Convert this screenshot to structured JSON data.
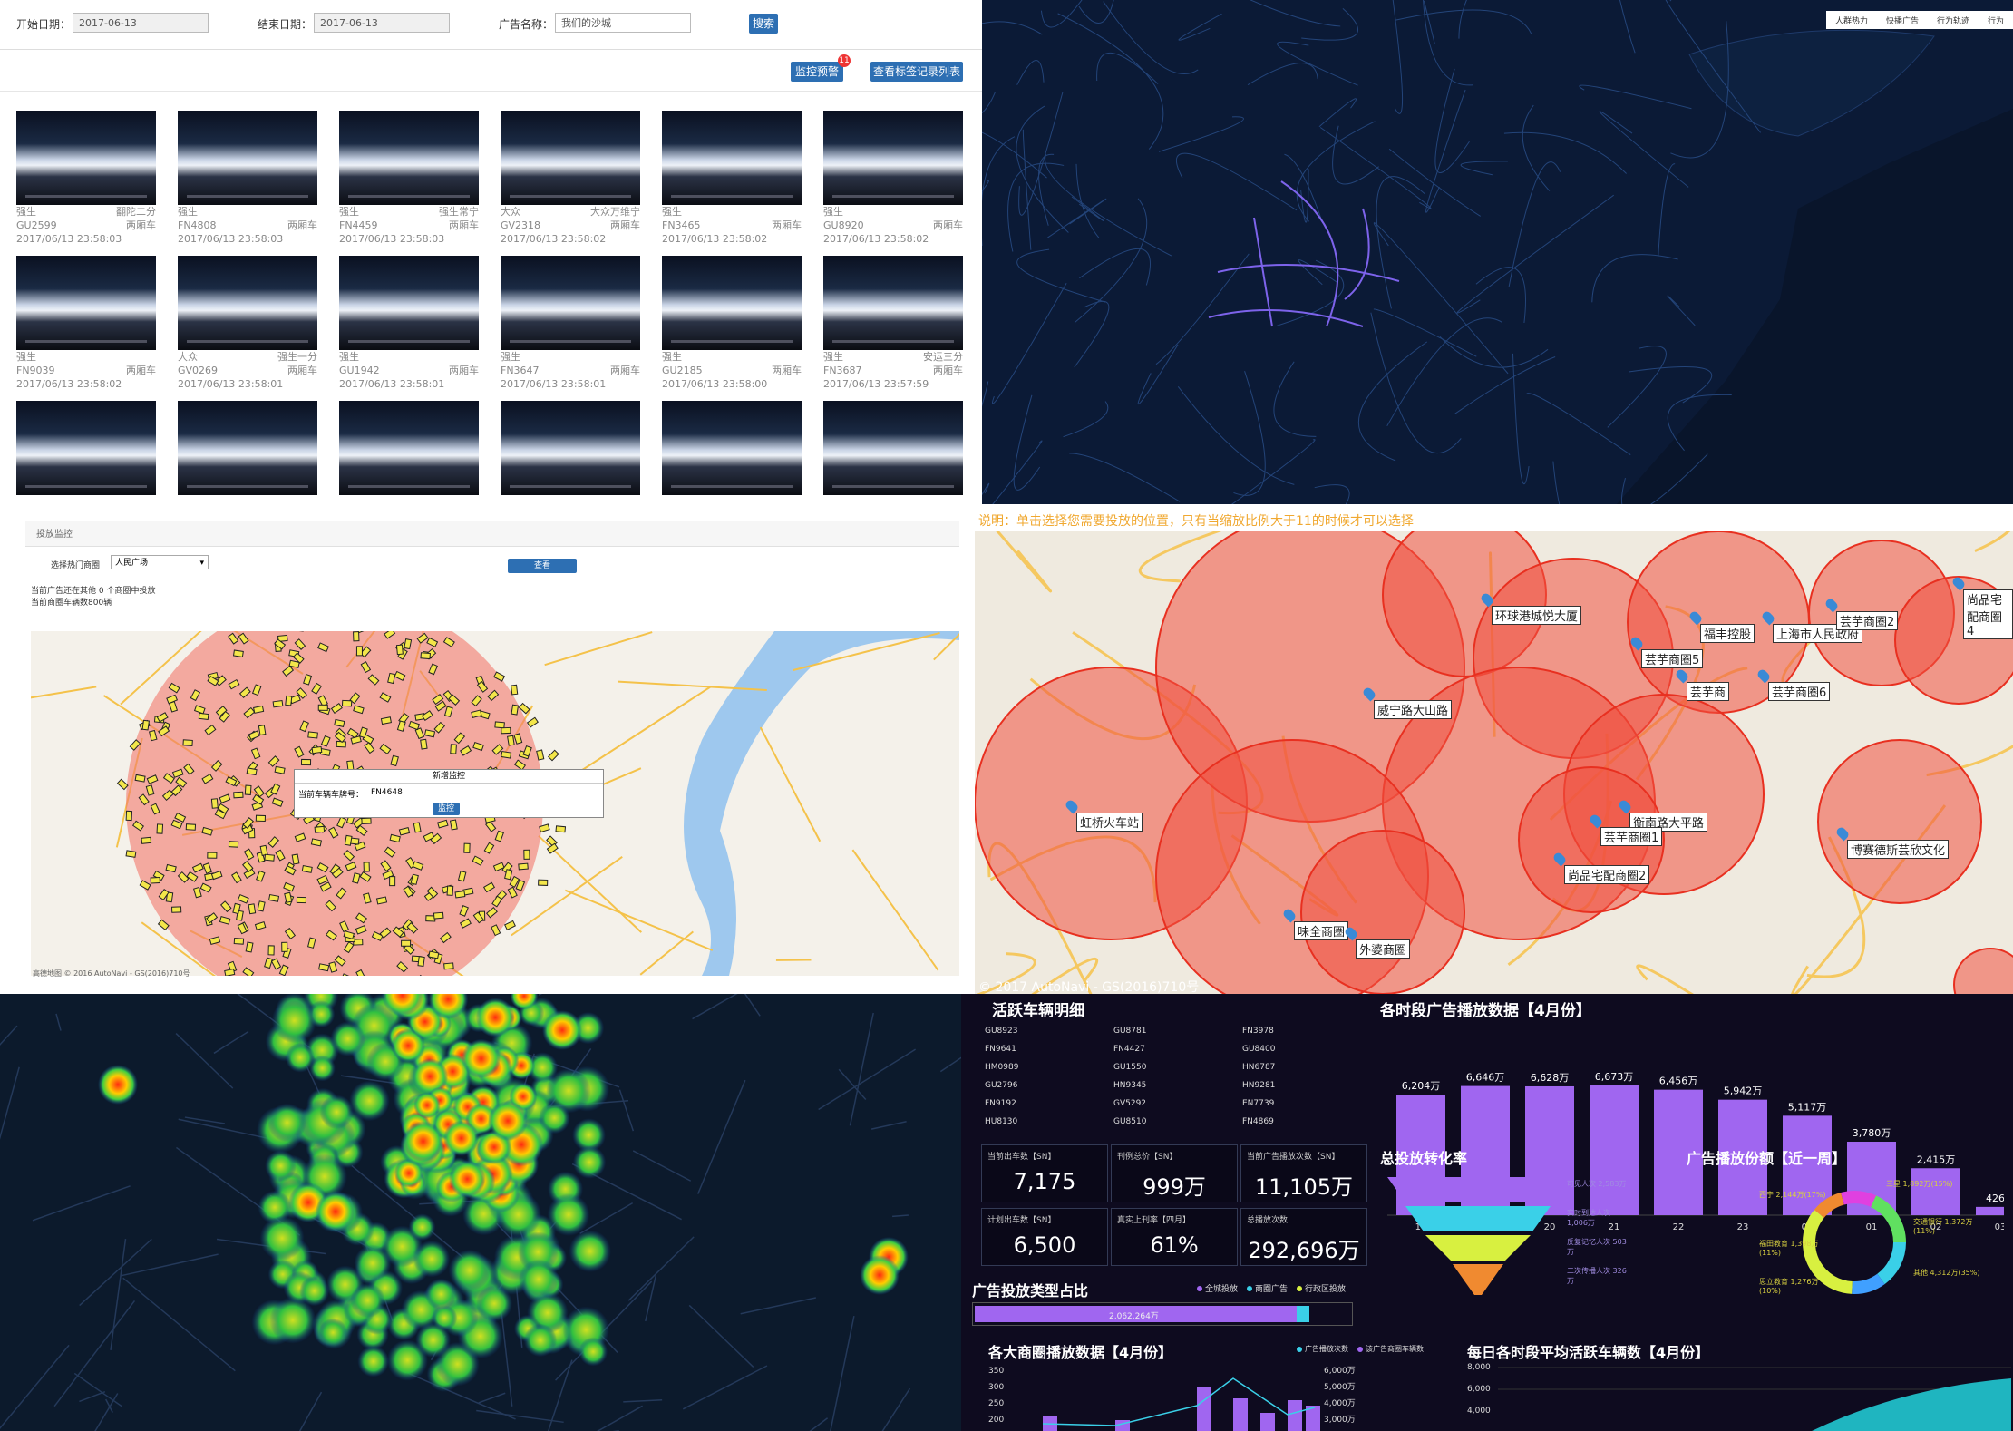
{
  "monitor": {
    "start_label": "开始日期：",
    "start_value": "2017-06-13",
    "end_label": "结束日期：",
    "end_value": "2017-06-13",
    "ad_label": "广告名称：",
    "ad_value": "我们的沙城",
    "search_btn": "搜索",
    "alert_btn": "监控预警",
    "alert_badge": "11",
    "log_btn": "查看标签记录列表",
    "thumbs": [
      {
        "brand": "强生",
        "tag": "翻陀二分",
        "plate": "GU2599",
        "type": "两厢车",
        "time": "2017/06/13 23:58:03"
      },
      {
        "brand": "强生",
        "tag": "",
        "plate": "FN4808",
        "type": "两厢车",
        "time": "2017/06/13 23:58:03"
      },
      {
        "brand": "强生",
        "tag": "强生常宁",
        "plate": "FN4459",
        "type": "两厢车",
        "time": "2017/06/13 23:58:03"
      },
      {
        "brand": "大众",
        "tag": "大众万维宁",
        "plate": "GV2318",
        "type": "两厢车",
        "time": "2017/06/13 23:58:02"
      },
      {
        "brand": "强生",
        "tag": "",
        "plate": "FN3465",
        "type": "两厢车",
        "time": "2017/06/13 23:58:02"
      },
      {
        "brand": "强生",
        "tag": "",
        "plate": "GU8920",
        "type": "两厢车",
        "time": "2017/06/13 23:58:02"
      },
      {
        "brand": "强生",
        "tag": "",
        "plate": "FN9039",
        "type": "两厢车",
        "time": "2017/06/13 23:58:02"
      },
      {
        "brand": "大众",
        "tag": "强生一分",
        "plate": "GV0269",
        "type": "两厢车",
        "time": "2017/06/13 23:58:01"
      },
      {
        "brand": "强生",
        "tag": "",
        "plate": "GU1942",
        "type": "两厢车",
        "time": "2017/06/13 23:58:01"
      },
      {
        "brand": "强生",
        "tag": "",
        "plate": "FN3647",
        "type": "两厢车",
        "time": "2017/06/13 23:58:01"
      },
      {
        "brand": "强生",
        "tag": "",
        "plate": "GU2185",
        "type": "两厢车",
        "time": "2017/06/13 23:58:00"
      },
      {
        "brand": "强生",
        "tag": "安运三分",
        "plate": "FN3687",
        "type": "两厢车",
        "time": "2017/06/13 23:57:59"
      },
      {
        "brand": "",
        "tag": "",
        "plate": "",
        "type": "",
        "time": ""
      },
      {
        "brand": "",
        "tag": "",
        "plate": "",
        "type": "",
        "time": ""
      },
      {
        "brand": "",
        "tag": "",
        "plate": "",
        "type": "",
        "time": ""
      },
      {
        "brand": "",
        "tag": "",
        "plate": "",
        "type": "",
        "time": ""
      },
      {
        "brand": "",
        "tag": "",
        "plate": "",
        "type": "",
        "time": ""
      },
      {
        "brand": "",
        "tag": "",
        "plate": "",
        "type": "",
        "time": ""
      }
    ]
  },
  "roadmap": {
    "tabs": [
      "人群热力",
      "快播广告",
      "行为轨迹",
      "行为"
    ]
  },
  "admonitor": {
    "section_title": "投放监控",
    "select_label": "选择热门商圈",
    "select_value": "人民广场",
    "query_btn": "查看",
    "info1": "当前广告还在其他 0 个商圈中投放",
    "info2": "当前商圈车辆数800辆",
    "popup_title": "新增监控",
    "popup_label": "当前车辆车牌号：",
    "popup_value": "FN4648",
    "popup_btn": "监控",
    "map_credit": "高德地图 © 2016 AutoNavi - GS(2016)710号"
  },
  "circlemap": {
    "note": "说明：单击选择您需要投放的位置，只有当缩放比例大于11的时候才可以选择",
    "credit": "© 2017 AutoNavi - GS(2016)710号",
    "labels": [
      "环球港城悦大厦",
      "福丰控股",
      "上海市人民政府",
      "芸芋商圈2",
      "尚品宅配商圈4",
      "芸芋商圈5",
      "芸芋商圈6",
      "芸芋商",
      "威宁路大山路",
      "虹桥火车站",
      "衡南路大平路",
      "芸芋商圈1",
      "尚品宅配商圈2",
      "博赛德斯芸欣文化",
      "味全商圈",
      "外婆商圈"
    ]
  },
  "dashboard": {
    "vehicles_title": "活跃车辆明细",
    "plates": [
      [
        "GU8923",
        "GU8781",
        "FN3978"
      ],
      [
        "FN9641",
        "FN4427",
        "GU8400"
      ],
      [
        "HM0989",
        "GU1550",
        "HN6787"
      ],
      [
        "GU2796",
        "HN9345",
        "HN9281"
      ],
      [
        "FN9192",
        "GV5292",
        "EN7739"
      ],
      [
        "HU8130",
        "GU8510",
        "FN4869"
      ]
    ],
    "kpis": [
      {
        "k": "当前出车数【SN】",
        "v": "7,175"
      },
      {
        "k": "刊例总价【SN】",
        "v": "999万"
      },
      {
        "k": "当前广告播放次数【SN】",
        "v": "11,105万"
      },
      {
        "k": "计划出车数【SN】",
        "v": "6,500"
      },
      {
        "k": "真实上刊率【四月】",
        "v": "61%"
      },
      {
        "k": "总播放次数",
        "v": "292,696万"
      }
    ],
    "funnel_title": "总投放转化率",
    "funnel_labels": [
      "可见人次 2,583万",
      "实时到达人次 1,006万",
      "反复记忆人次 503万",
      "二次传播人次 326万"
    ],
    "share_title": "广告播放份额【近一周】",
    "share_labels": [
      "三星 1,892万(15%)",
      "交通银行 1,372万(11%)",
      "其他 4,312万(35%)",
      "思立教育 1,276万(10%)",
      "福田教育 1,398万(11%)",
      "西宁 2,144万(17%)"
    ],
    "type_title": "广告投放类型占比",
    "type_legend": [
      "全城投放",
      "商圈广告",
      "行政区投放"
    ],
    "type_value": "2,062,264万",
    "district_title": "各大商圈播放数据【4月份】",
    "district_legend": [
      "广告播放次数",
      "该广告商圈车辆数"
    ],
    "district_y": [
      "350",
      "300",
      "250",
      "200"
    ],
    "district_y2": [
      "6,000万",
      "5,000万",
      "4,000万",
      "3,000万"
    ],
    "daily_title": "每日各时段平均活跃车辆数【4月份】",
    "daily_y": [
      "8,000",
      "6,000",
      "4,000"
    ]
  },
  "chart_data": {
    "type": "bar",
    "title": "各时段广告播放数据【4月份】",
    "categories": [
      "18",
      "19",
      "20",
      "21",
      "22",
      "23",
      "00",
      "01",
      "02",
      "03"
    ],
    "values": [
      6204,
      6646,
      6628,
      6673,
      6456,
      5942,
      5117,
      3780,
      2415,
      426
    ],
    "value_labels": [
      "6,204万",
      "6,646万",
      "6,628万",
      "6,673万",
      "6,456万",
      "5,942万",
      "5,117万",
      "3,780万",
      "2,415万",
      "426万"
    ],
    "ylim": [
      0,
      7000
    ]
  },
  "colors": {
    "accent": "#2d6fb3",
    "bar": "#a066f0",
    "dark": "#0b1a36",
    "circle": "#f05040"
  }
}
